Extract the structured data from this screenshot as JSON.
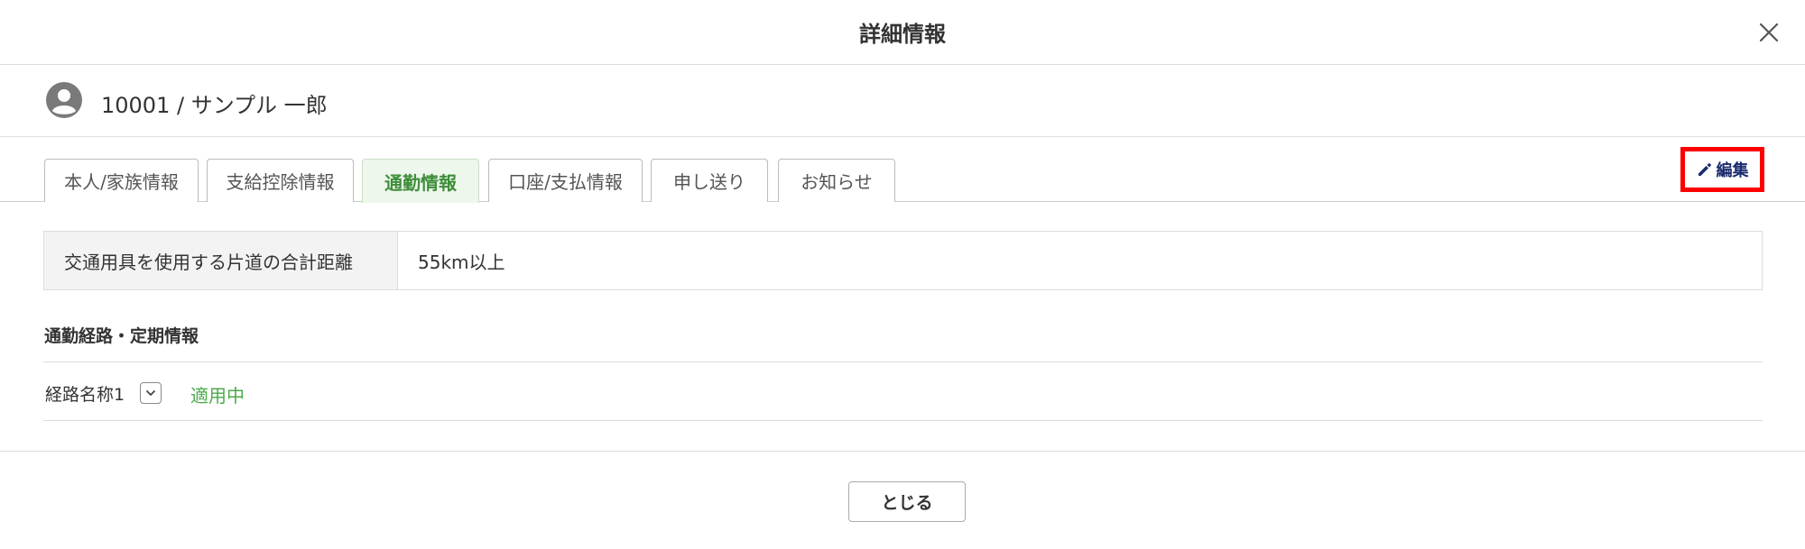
{
  "modal": {
    "title": "詳細情報"
  },
  "user": {
    "label": "10001 / サンプル 一郎"
  },
  "tabs": [
    {
      "label": "本人/家族情報",
      "active": false
    },
    {
      "label": "支給控除情報",
      "active": false
    },
    {
      "label": "通勤情報",
      "active": true
    },
    {
      "label": "口座/支払情報",
      "active": false
    },
    {
      "label": "申し送り",
      "active": false
    },
    {
      "label": "お知らせ",
      "active": false
    }
  ],
  "toolbar": {
    "edit_label": "編集"
  },
  "distance": {
    "header": "交通用具を使用する片道の合計距離",
    "value": "55km以上"
  },
  "commute_section": {
    "title": "通勤経路・定期情報",
    "routes": [
      {
        "name": "経路名称1",
        "status": "適用中"
      }
    ]
  },
  "footer": {
    "close_label": "とじる"
  },
  "colors": {
    "accent_green": "#3e8e3a",
    "status_green": "#4caa4a",
    "highlight_red": "#ff0000",
    "edit_navy": "#1a2a6c"
  },
  "icons": {
    "close": "close-icon",
    "avatar": "user-circle-icon",
    "edit": "pencil-icon",
    "toggle": "chevron-down-icon"
  }
}
